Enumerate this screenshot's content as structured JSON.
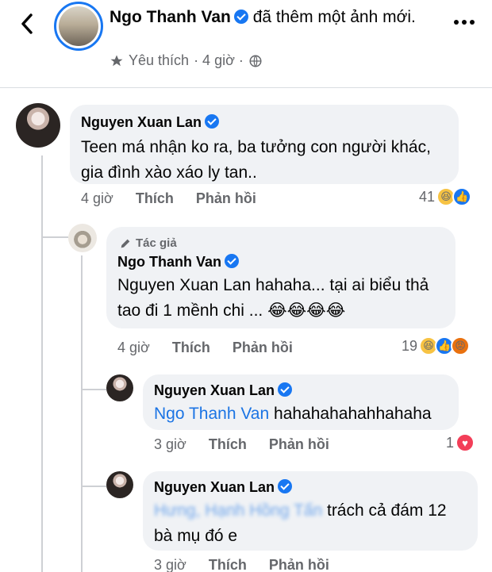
{
  "header": {
    "author": "Ngo Thanh Van",
    "action": "đã thêm một ảnh mới.",
    "meta_like": "Yêu thích",
    "meta_time": "· 4 giờ ·"
  },
  "comments": [
    {
      "name": "Nguyen Xuan Lan",
      "text_line1": "Teen má nhận ko ra, ba tưởng con người khác,",
      "text_line2": "gia đình xào xáo ly tan..",
      "time": "4 giờ",
      "like": "Thích",
      "reply": "Phản hồi",
      "reaction_count": "41"
    },
    {
      "badge": "Tác giả",
      "name": "Ngo Thanh Van",
      "text_line1": "Nguyen Xuan Lan hahaha... tại ai biểu thả",
      "text_line2": "tao đi 1 mềnh chi ... 😂😂😂😂",
      "time": "4 giờ",
      "like": "Thích",
      "reply": "Phản hồi",
      "reaction_count": "19"
    },
    {
      "name": "Nguyen Xuan Lan",
      "tag": "Ngo Thanh Van",
      "text": "hahahahahahhahaha",
      "time": "3 giờ",
      "like": "Thích",
      "reply": "Phản hồi",
      "reaction_count": "1"
    },
    {
      "name": "Nguyen Xuan Lan",
      "blurred": "Hưng, Hạnh Hồng Tấn",
      "text_line1": "trách cả đám 12",
      "text_line2": "bà mụ đó e",
      "time": "3 giờ",
      "like": "Thích",
      "reply": "Phản hồi"
    }
  ],
  "colors": {
    "accent": "#1877f2",
    "bubble": "#f0f2f5",
    "muted": "#65676b"
  }
}
